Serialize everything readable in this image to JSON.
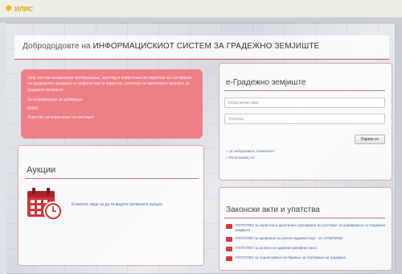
{
  "topbar": {
    "logo_text": "ИЛИС"
  },
  "header": {
    "title_prefix": "Добродојдовте на ",
    "title_main": "ИНФОРМАЦИСКИОТ СИСТЕМ ЗА ГРАДЕЖНО ЗЕМЈИШТЕ"
  },
  "intro": {
    "paragraph": "Овој систем овозможува пребарување, преглед и користење на податоци за состојбата на градежното земјиште и субјекти кои го користат, согласно со законските прописи за градежно земјиште.",
    "line1": "За информации за добивање",
    "line2": "ИЛИС",
    "line3": "Упатство за користење на системот"
  },
  "services": {
    "title": "Аукции",
    "link": "Кликнете овде за да ги видите активните аукции"
  },
  "login": {
    "title": "е-Градежно земјиште",
    "username_placeholder": "Корисничко име",
    "password_placeholder": "Лозинка",
    "submit_label": "Најави се",
    "forgot_link": "» Ја заборавивте лозинката?",
    "register_link": "» Регистрирај се!"
  },
  "acts": {
    "title": "Законски акти и упатства",
    "items": [
      "УПАТСТВО за користење дигитален сертификат во системот за управување со градежно земјиште",
      "УПАТСТВО за креирање на рачни надоместоци - ЗА ОПШТИНИ",
      "УПАТСТВО за уплата на административни такси",
      "УПАТСТВО за поднесување на барање за отуѓување на градежно"
    ]
  },
  "colors": {
    "accent": "#c84c5a",
    "intro_bg": "#ef7f86",
    "logo": "#e3a019",
    "link": "#5a6fa8"
  }
}
